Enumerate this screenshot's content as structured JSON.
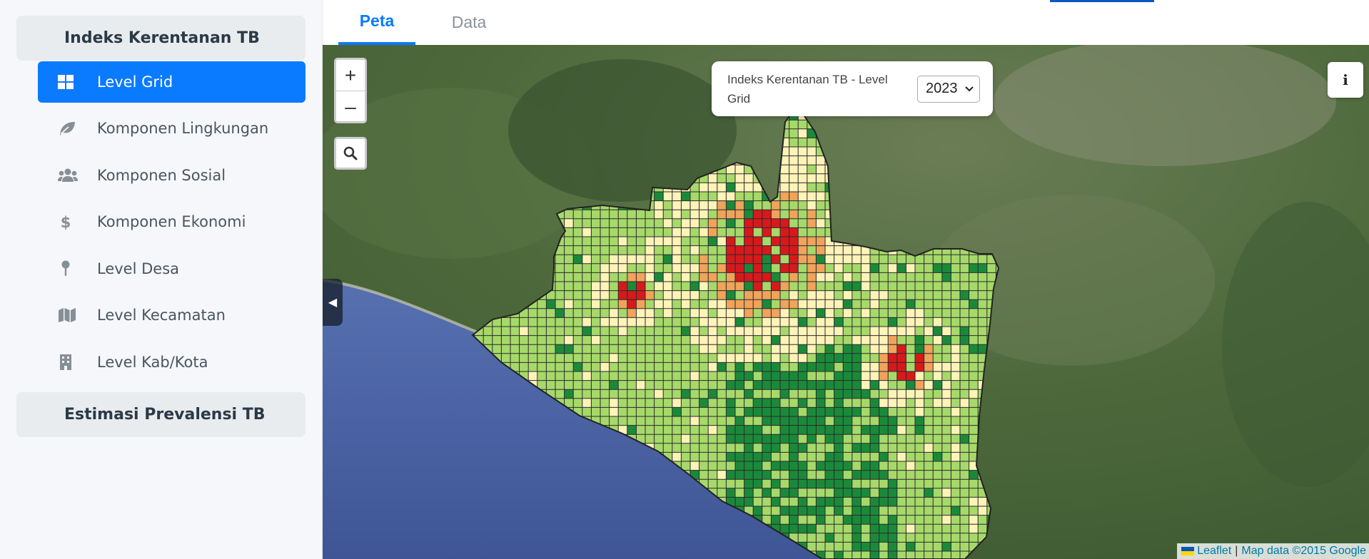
{
  "sidebar": {
    "group1": "Indeks Kerentanan TB",
    "group2": "Estimasi Prevalensi TB",
    "items": [
      {
        "label": "Level Grid",
        "icon": "grid-icon",
        "active": true
      },
      {
        "label": "Komponen Lingkungan",
        "icon": "leaf-icon",
        "active": false
      },
      {
        "label": "Komponen Sosial",
        "icon": "users-icon",
        "active": false
      },
      {
        "label": "Komponen Ekonomi",
        "icon": "dollar-icon",
        "active": false
      },
      {
        "label": "Level Desa",
        "icon": "map-pin-icon",
        "active": false
      },
      {
        "label": "Level Kecamatan",
        "icon": "map-icon",
        "active": false
      },
      {
        "label": "Level Kab/Kota",
        "icon": "building-icon",
        "active": false
      }
    ]
  },
  "tabs": [
    {
      "label": "Peta",
      "active": true
    },
    {
      "label": "Data",
      "active": false
    }
  ],
  "map": {
    "zoom_in": "+",
    "zoom_out": "–",
    "search_icon": "search-icon",
    "collapse_icon": "◀",
    "title": "Indeks Kerentanan TB - Level Grid",
    "year_selected": "2023",
    "info_label": "i",
    "attribution_leaflet": "Leaflet",
    "attribution_sep": "|",
    "attribution_data": "Map data ©2015 Google",
    "legend_colors": {
      "very_low": "#1a8a3a",
      "low": "#a6d96a",
      "medium": "#fff3b8",
      "high": "#f0a35a",
      "very_high": "#d7191c"
    },
    "colors": {
      "accent": "#0a7aff",
      "sea": "#4a63a8",
      "land": "#4d6a3a"
    }
  }
}
